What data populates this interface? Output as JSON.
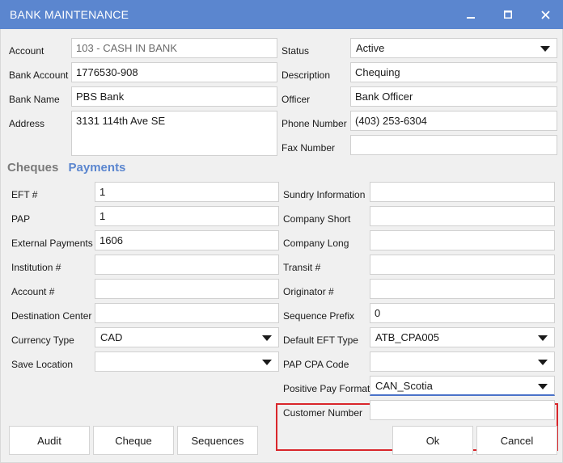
{
  "window": {
    "title": "BANK MAINTENANCE"
  },
  "bank": {
    "account_label": "Account",
    "account_value": "103 - CASH IN BANK",
    "bank_account_label": "Bank Account",
    "bank_account_value": "1776530-908",
    "bank_name_label": "Bank Name",
    "bank_name_value": "PBS Bank",
    "address_label": "Address",
    "address_value": "3131 114th Ave SE",
    "status_label": "Status",
    "status_value": "Active",
    "description_label": "Description",
    "description_value": "Chequing",
    "officer_label": "Officer",
    "officer_value": "Bank Officer",
    "phone_label": "Phone Number",
    "phone_value": "(403) 253-6304",
    "fax_label": "Fax Number",
    "fax_value": ""
  },
  "tabs": [
    {
      "label": "Cheques",
      "active": false
    },
    {
      "label": "Payments",
      "active": true
    }
  ],
  "payments": {
    "eft_label": "EFT #",
    "eft_value": "1",
    "pap_label": "PAP",
    "pap_value": "1",
    "external_label": "External Payments",
    "external_value": "1606",
    "institution_label": "Institution #",
    "institution_value": "",
    "account_label": "Account #",
    "account_value": "",
    "destination_label": "Destination Center",
    "destination_value": "",
    "currency_label": "Currency Type",
    "currency_value": "CAD",
    "save_location_label": "Save Location",
    "save_location_value": "",
    "sundry_label": "Sundry Information",
    "sundry_value": "",
    "company_short_label": "Company Short",
    "company_short_value": "",
    "company_long_label": "Company Long",
    "company_long_value": "",
    "transit_label": "Transit #",
    "transit_value": "",
    "originator_label": "Originator #",
    "originator_value": "",
    "sequence_prefix_label": "Sequence Prefix",
    "sequence_prefix_value": "0",
    "default_eft_label": "Default EFT Type",
    "default_eft_value": "ATB_CPA005",
    "pap_cpa_label": "PAP CPA Code",
    "pap_cpa_value": "",
    "positive_pay_label": "Positive Pay Format",
    "positive_pay_value": "CAN_Scotia",
    "customer_number_label": "Customer Number",
    "customer_number_value": ""
  },
  "buttons": {
    "audit": "Audit",
    "cheque": "Cheque",
    "sequences": "Sequences",
    "ok": "Ok",
    "cancel": "Cancel"
  },
  "colors": {
    "titlebar": "#5b86cf",
    "active_tab": "#5b86cf",
    "highlight_border": "#d9262b"
  }
}
